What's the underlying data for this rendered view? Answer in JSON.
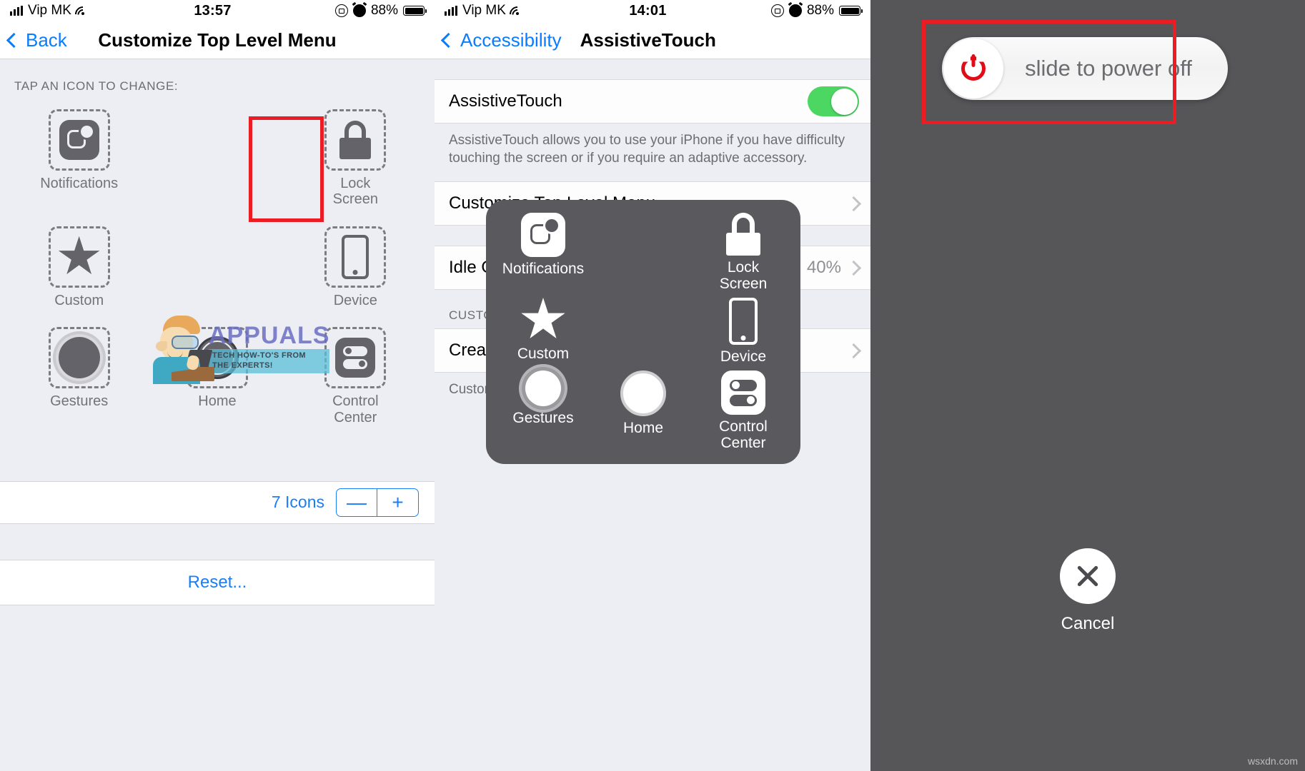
{
  "left_screen": {
    "status_bar": {
      "carrier": "Vip MK",
      "time": "13:57",
      "battery_percent": "88%",
      "icons": [
        "signal-bars-icon",
        "wifi-icon",
        "rotation-lock-icon",
        "alarm-clock-icon",
        "battery-icon"
      ]
    },
    "nav": {
      "back_label": "Back",
      "title": "Customize Top Level Menu"
    },
    "section_header": "TAP AN ICON TO CHANGE:",
    "icons": [
      {
        "label": "Notifications",
        "glyph": "notifications-icon",
        "highlighted": false
      },
      {
        "label": "",
        "glyph": "empty-slot",
        "highlighted": false
      },
      {
        "label": "Lock\nScreen",
        "glyph": "lock-icon",
        "highlighted": true
      },
      {
        "label": "Custom",
        "glyph": "star-icon",
        "highlighted": false
      },
      {
        "label": "",
        "glyph": "empty-slot",
        "highlighted": false
      },
      {
        "label": "Device",
        "glyph": "device-icon",
        "highlighted": false
      },
      {
        "label": "Gestures",
        "glyph": "gestures-icon",
        "highlighted": false
      },
      {
        "label": "Home",
        "glyph": "home-icon",
        "highlighted": false
      },
      {
        "label": "Control\nCenter",
        "glyph": "control-center-icon",
        "highlighted": false
      }
    ],
    "icon_count_label": "7 Icons",
    "stepper": {
      "minus": "—",
      "plus": "+"
    },
    "reset_label": "Reset..."
  },
  "middle_screen": {
    "status_bar": {
      "carrier": "Vip MK",
      "time": "14:01",
      "battery_percent": "88%"
    },
    "nav": {
      "back_label": "Accessibility",
      "title": "AssistiveTouch"
    },
    "rows": [
      {
        "title": "AssistiveTouch",
        "type": "toggle",
        "toggle_on": true
      },
      {
        "footnote": "AssistiveTouch allows you to use your iPhone if you have difficulty touching the screen or if you require an adaptive accessory."
      },
      {
        "title": "Customize Top Level Menu",
        "type": "disclosure",
        "value": ""
      },
      {
        "title": "Idle Opacity",
        "type": "disclosure",
        "value": "40%"
      },
      {
        "group_header": "CUSTOM ACTIONS"
      },
      {
        "title": "Create New Gesture...",
        "type": "disclosure",
        "value": ""
      },
      {
        "footnote": "Custom gestures can be used with the activate action."
      }
    ],
    "assistive_menu": [
      {
        "label": "Notifications",
        "glyph": "notifications-icon",
        "highlighted": false
      },
      {
        "label": "",
        "glyph": "empty-slot",
        "highlighted": false
      },
      {
        "label": "Lock\nScreen",
        "glyph": "lock-icon",
        "highlighted": true
      },
      {
        "label": "Custom",
        "glyph": "star-icon",
        "highlighted": false
      },
      {
        "label": "",
        "glyph": "empty-slot",
        "highlighted": false
      },
      {
        "label": "Device",
        "glyph": "device-icon",
        "highlighted": false
      },
      {
        "label": "Gestures",
        "glyph": "gestures-icon",
        "highlighted": false
      },
      {
        "label": "Home",
        "glyph": "home-icon",
        "highlighted": false
      },
      {
        "label": "Control\nCenter",
        "glyph": "control-center-icon",
        "highlighted": false
      }
    ]
  },
  "right_screen": {
    "slider_label": "slide to power off",
    "power_icon": "power-icon",
    "cancel_label": "Cancel",
    "cancel_icon": "close-x-icon"
  },
  "watermark": {
    "title": "APPUALS",
    "subtitle": "TECH HOW-TO'S FROM\nTHE EXPERTS!",
    "corner": "wsxdn.com"
  },
  "colors": {
    "highlight_red": "#ec1c24",
    "ios_blue": "#0a7cff",
    "toggle_green": "#4cd763",
    "power_red": "#e00c18",
    "panel_grey": "#eceef3",
    "overlay_grey": "#5a5a5e"
  }
}
